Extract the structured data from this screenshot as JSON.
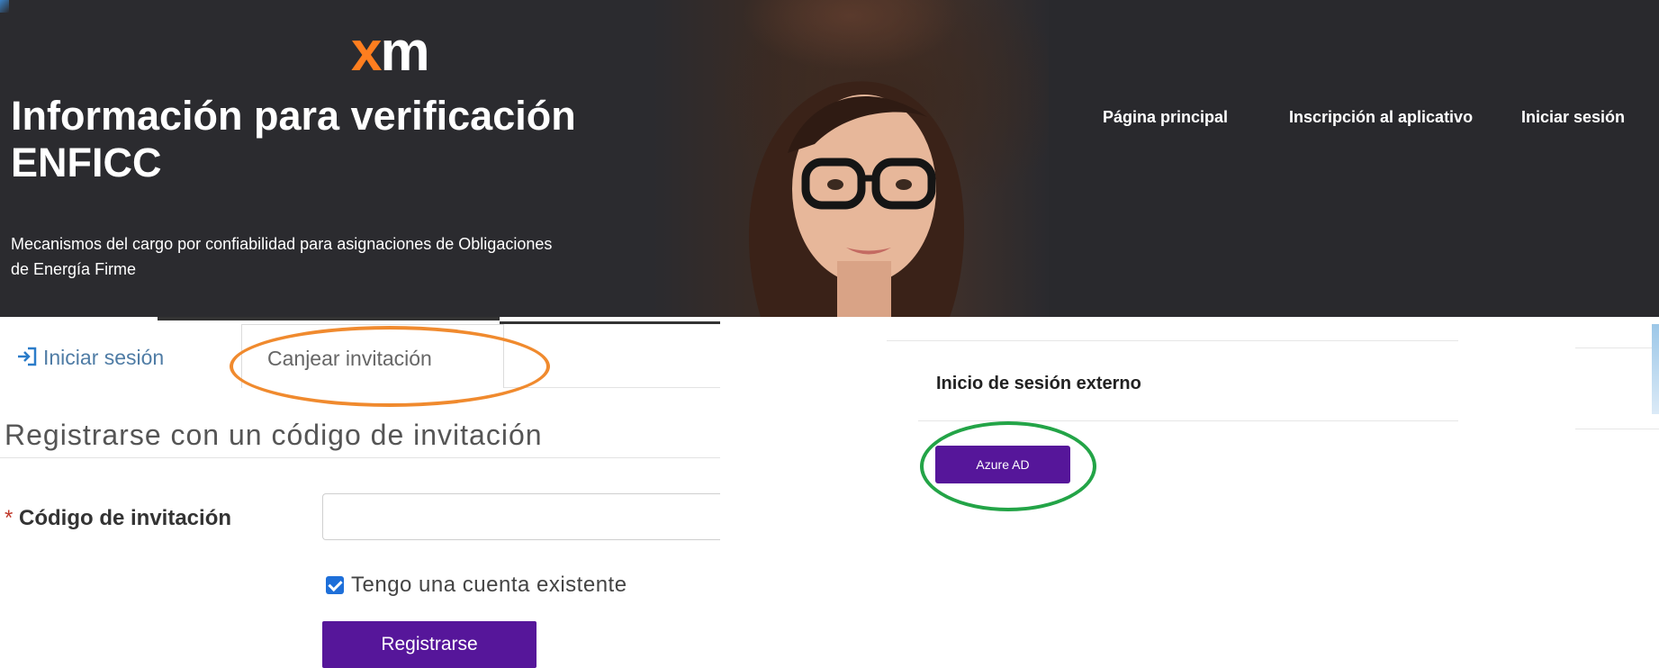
{
  "header": {
    "logo": {
      "x": "x",
      "m": "m"
    },
    "title_line1": "Información para verificación",
    "title_line2": "ENFICC",
    "subtitle_line1": "Mecanismos del cargo por confiabilidad para asignaciones de Obligaciones",
    "subtitle_line2": "de Energía Firme",
    "nav": [
      {
        "label": "Página principal"
      },
      {
        "label": "Inscripción al aplicativo"
      },
      {
        "label": "Iniciar sesión"
      }
    ]
  },
  "tabs": {
    "login_label": "Iniciar sesión",
    "redeem_label": "Canjear invitación"
  },
  "register": {
    "title": "Registrarse con un código de invitación",
    "code_label": "Código de invitación",
    "required_mark": "*",
    "code_value": "",
    "existing_account_label": "Tengo una cuenta existente",
    "existing_account_checked": true,
    "submit_label": "Registrarse"
  },
  "external": {
    "title": "Inicio de sesión externo",
    "azure_label": "Azure AD"
  },
  "colors": {
    "header_bg": "#2a2a2e",
    "logo_accent": "#ff7e1f",
    "button_purple": "#56169a",
    "highlight_orange": "#f08a2e",
    "highlight_green": "#23a447",
    "link_blue": "#4f7ca5"
  },
  "icons": {
    "login_tab": "sign-in-icon",
    "checkbox": "checkmark-icon"
  }
}
